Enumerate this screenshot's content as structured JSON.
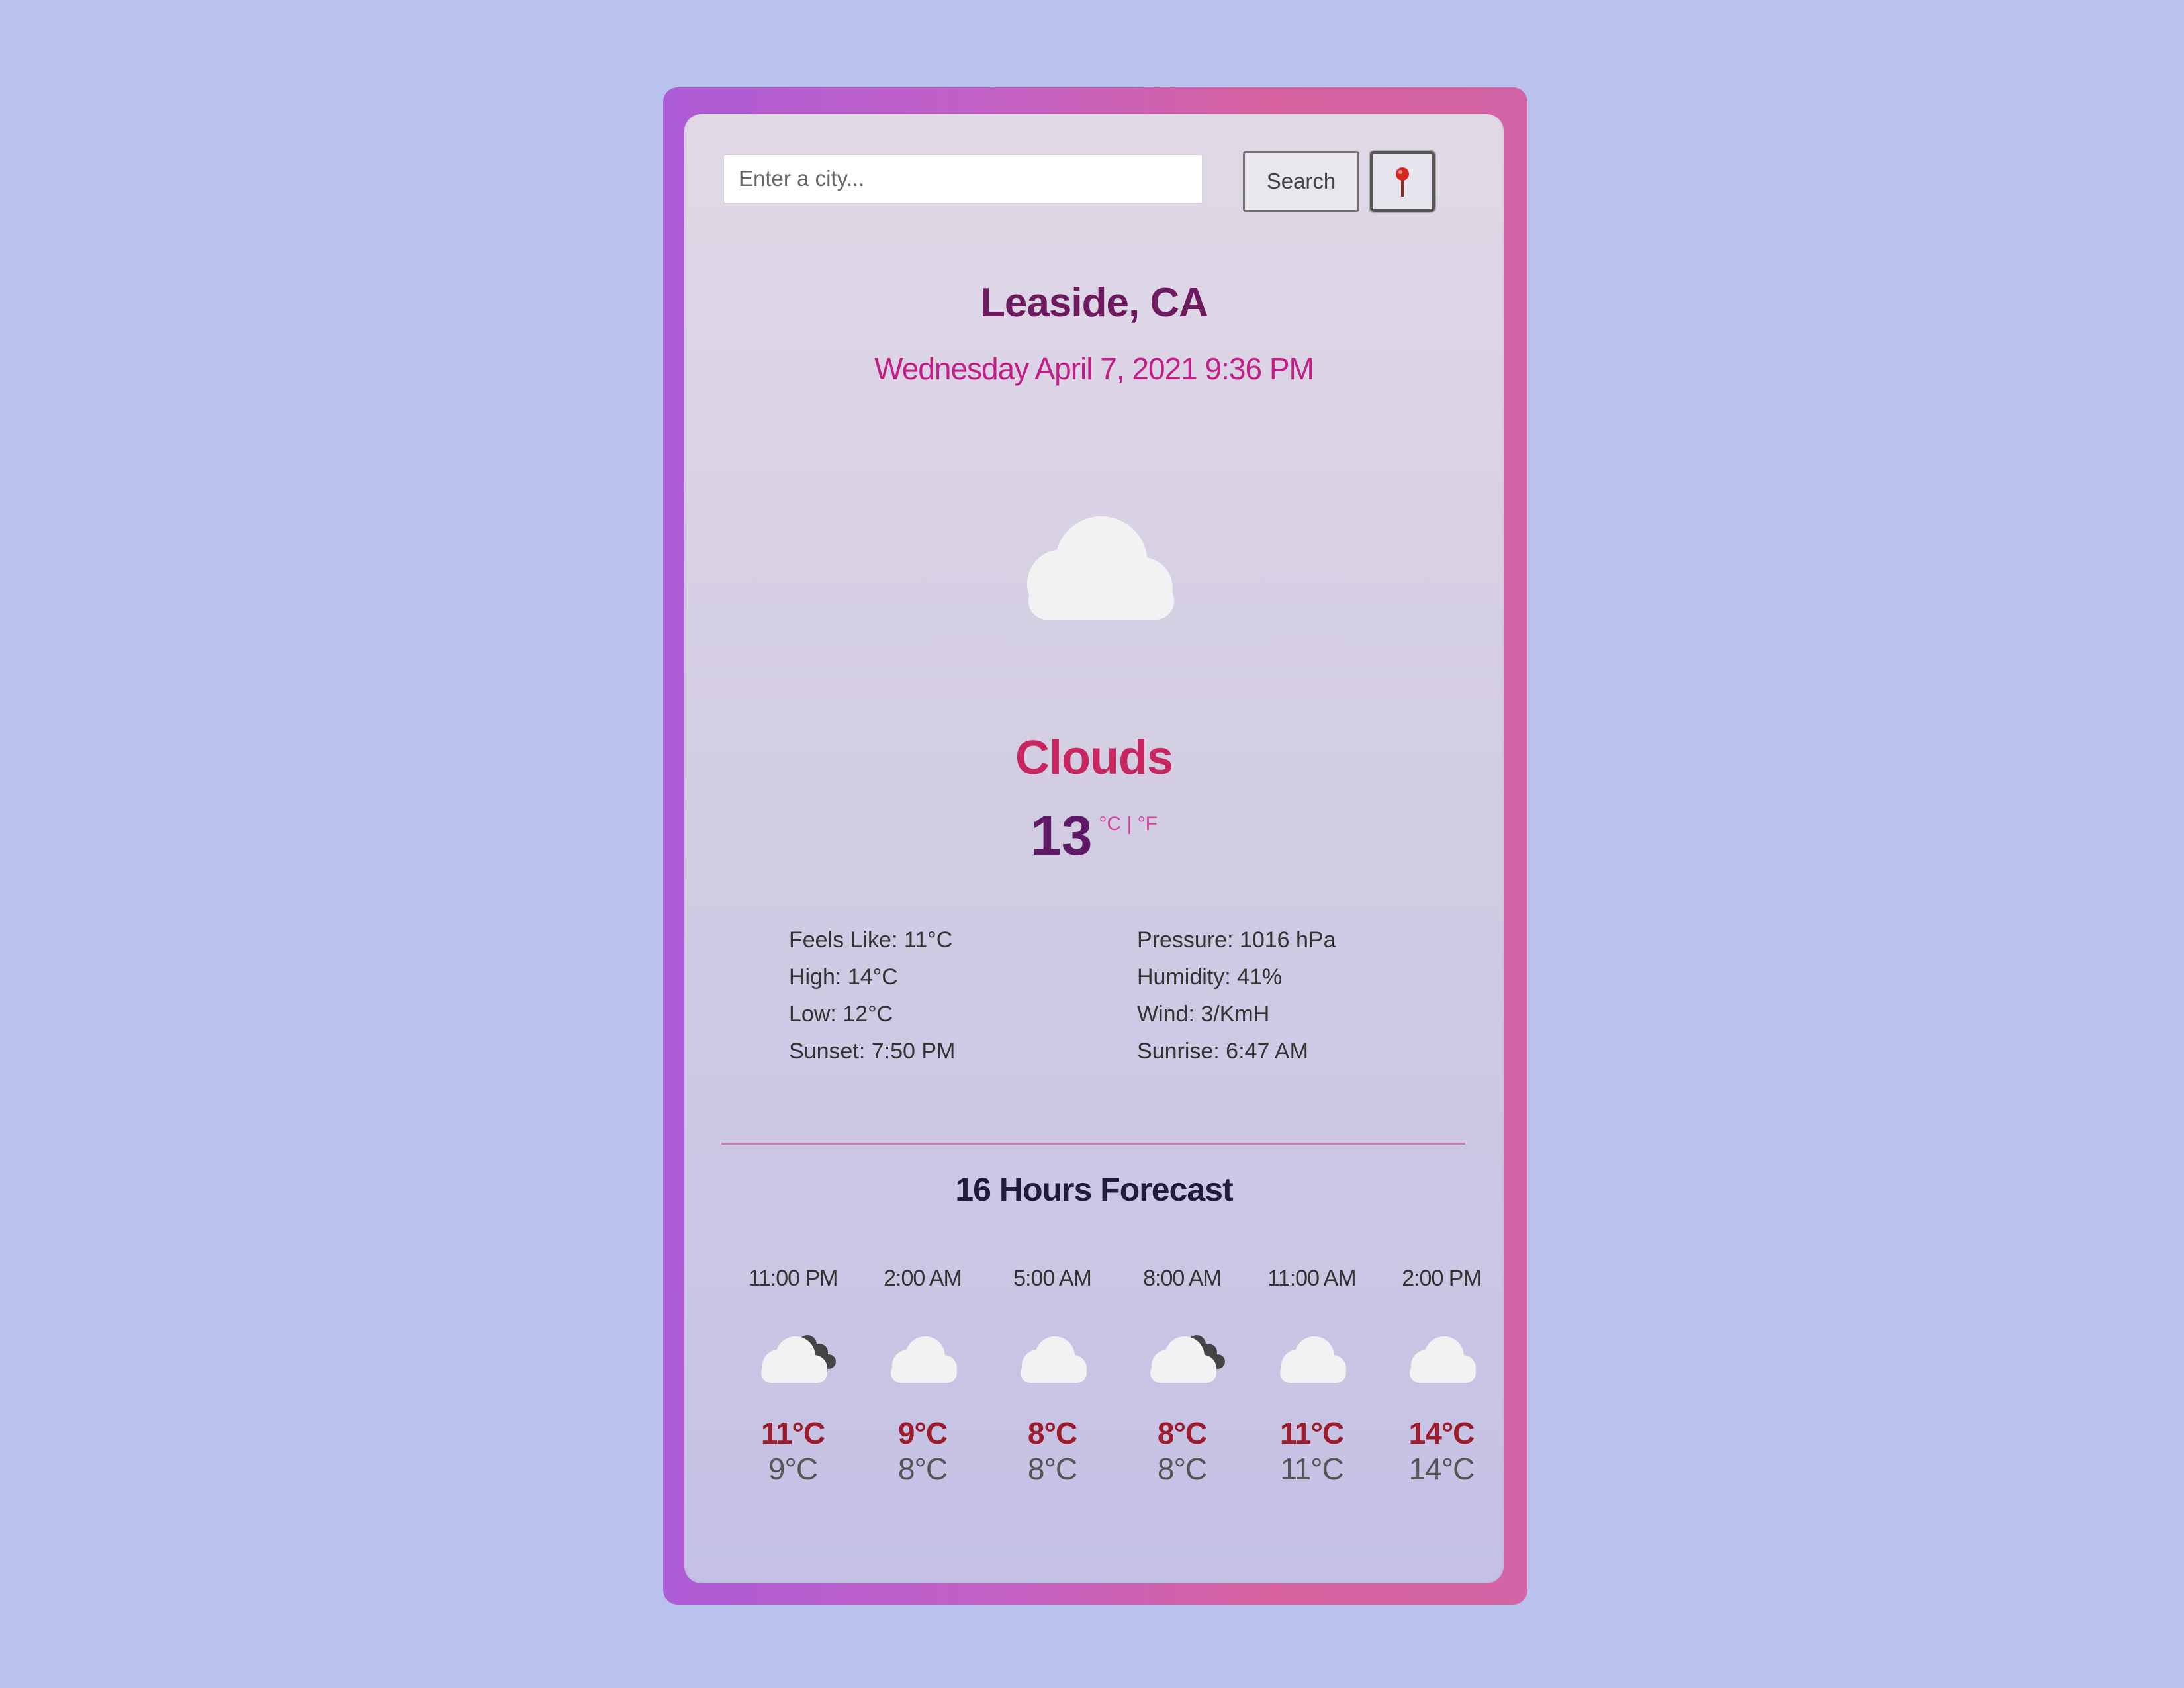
{
  "search": {
    "placeholder": "Enter a city...",
    "button_label": "Search"
  },
  "location": {
    "city": "Leaside, CA",
    "datetime": "Wednesday April 7, 2021 9:36 PM"
  },
  "current": {
    "icon": "cloud-icon",
    "condition": "Clouds",
    "temperature": "13",
    "unit_celsius": "°C",
    "unit_separator": "|",
    "unit_fahrenheit": "°F"
  },
  "details": {
    "feels_like": "Feels Like: 11°C",
    "high": "High: 14°C",
    "low": "Low: 12°C",
    "sunset": "Sunset: 7:50 PM",
    "pressure": "Pressure: 1016 hPa",
    "humidity": "Humidity: 41%",
    "wind": "Wind: 3/KmH",
    "sunrise": "Sunrise: 6:47 AM"
  },
  "forecast": {
    "title": "16 Hours Forecast",
    "items": [
      {
        "time": "11:00 PM",
        "icon": "broken-clouds-icon",
        "high": "11°C",
        "low": "9°C"
      },
      {
        "time": "2:00 AM",
        "icon": "cloud-icon",
        "high": "9°C",
        "low": "8°C"
      },
      {
        "time": "5:00 AM",
        "icon": "cloud-icon",
        "high": "8°C",
        "low": "8°C"
      },
      {
        "time": "8:00 AM",
        "icon": "broken-clouds-icon",
        "high": "8°C",
        "low": "8°C"
      },
      {
        "time": "11:00 AM",
        "icon": "cloud-icon",
        "high": "11°C",
        "low": "11°C"
      },
      {
        "time": "2:00 PM",
        "icon": "cloud-icon",
        "high": "14°C",
        "low": "14°C"
      }
    ]
  },
  "colors": {
    "page_background": "#b8c2ec",
    "city": "#6d1a5e",
    "datetime": "#c21e86",
    "condition": "#c7275e",
    "temperature": "#5e1a66",
    "forecast_high": "#9c1c2c"
  }
}
